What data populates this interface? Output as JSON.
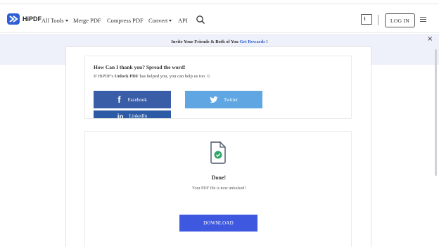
{
  "header": {
    "logo_text": "HiPDF",
    "nav": {
      "all_tools": "All Tools",
      "merge_pdf": "Merge PDF",
      "compress_pdf": "Compress PDF",
      "convert": "Convert",
      "api": "API"
    },
    "download_icon_glyph": "⭳",
    "login_label": "LOG IN"
  },
  "invite": {
    "text": "Invite Your Friends & Both of You ",
    "link": "Get Rewards",
    "suffix": " !",
    "close": "×"
  },
  "share": {
    "title": "How Can I thank you? Spread the word!",
    "subtitle_prefix": "If HiPDF's ",
    "subtitle_tool": "Unlock PDF",
    "subtitle_suffix": " has helped you, you can help us too ☺",
    "facebook_icon": "f",
    "facebook_label": "Facebook",
    "twitter_label": "Twitter",
    "linkedin_icon": "in",
    "linkedin_label": "LinkedIn"
  },
  "result": {
    "title": "Done!",
    "subtitle": "Your PDF file is now unlocked!",
    "download_label": "DOWNLOAD"
  },
  "colors": {
    "brand": "#2f5fd6",
    "facebook": "#3a5da8",
    "twitter": "#5fa6e2",
    "linkedin": "#2d5aa5",
    "download": "#3f58e0",
    "success": "#2fa76a"
  }
}
